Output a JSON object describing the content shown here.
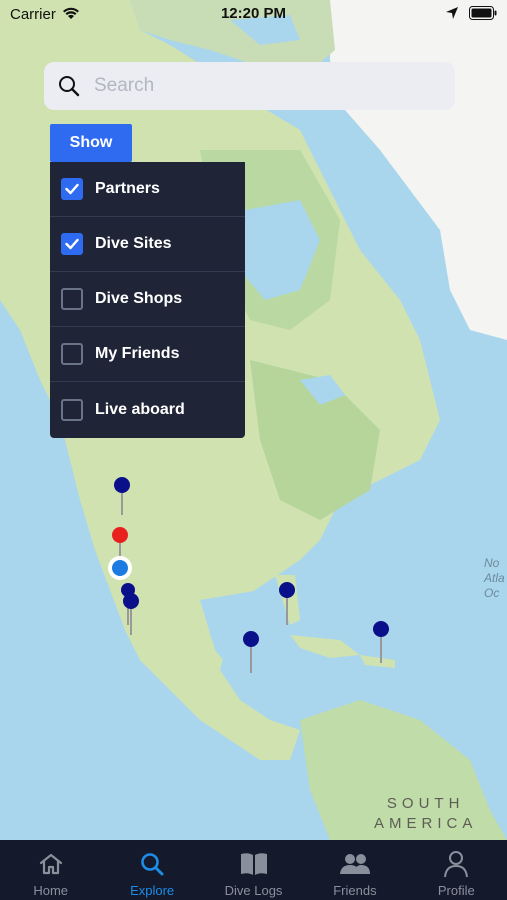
{
  "status": {
    "carrier": "Carrier",
    "time": "12:20 PM"
  },
  "search": {
    "placeholder": "Search",
    "value": ""
  },
  "show_button": "Show",
  "filters": [
    {
      "label": "Partners",
      "checked": true
    },
    {
      "label": "Dive Sites",
      "checked": true
    },
    {
      "label": "Dive Shops",
      "checked": false
    },
    {
      "label": "My Friends",
      "checked": false
    },
    {
      "label": "Live aboard",
      "checked": false
    }
  ],
  "map_labels": {
    "ocean_line1": "No",
    "ocean_line2": "Atla",
    "ocean_line3": "Oc",
    "continent_line1": "SOUTH",
    "continent_line2": "AMERICA"
  },
  "tabs": [
    {
      "label": "Home",
      "icon": "home-icon",
      "active": false
    },
    {
      "label": "Explore",
      "icon": "search-icon",
      "active": true
    },
    {
      "label": "Dive Logs",
      "icon": "book-icon",
      "active": false
    },
    {
      "label": "Friends",
      "icon": "friends-icon",
      "active": false
    },
    {
      "label": "Profile",
      "icon": "profile-icon",
      "active": false
    }
  ],
  "colors": {
    "accent": "#2f6bf0",
    "tab_active": "#1c8ce8",
    "panel": "#1f2537",
    "pin_blue": "#0a0f8a",
    "pin_red": "#e8201e"
  }
}
